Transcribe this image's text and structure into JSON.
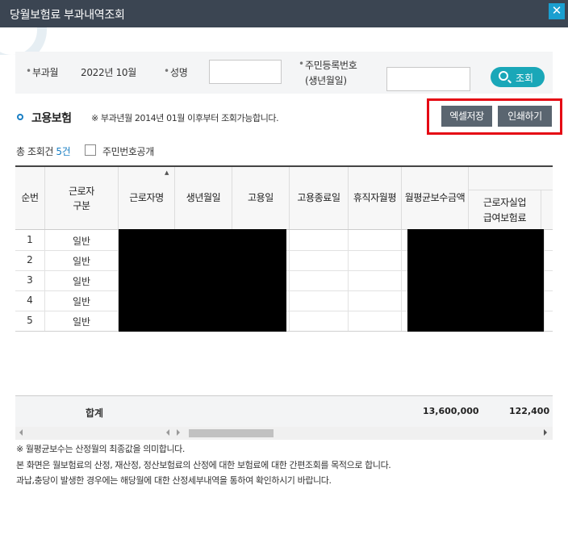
{
  "window": {
    "title": "당월보험료 부과내역조회",
    "close_icon": "✕"
  },
  "search": {
    "month_label": "부과월",
    "month_value": "2022년 10월",
    "name_label": "성명",
    "name_value": "",
    "rrn_label_1": "주민등록번호",
    "rrn_label_2": "(생년월일)",
    "rrn_value": "",
    "search_button": "조회"
  },
  "section": {
    "title": "고용보험",
    "note": "※ 부과년월 2014년 01월 이후부터 조회가능합니다.",
    "excel_button": "엑셀저장",
    "print_button": "인쇄하기"
  },
  "summary": {
    "total_label": "총 조회건",
    "total_count": "5건",
    "show_rrn_label": "주민번호공개"
  },
  "table": {
    "headers": {
      "no": "순번",
      "worker_type_1": "근로자",
      "worker_type_2": "구분",
      "worker_name": "근로자명",
      "birth": "생년월일",
      "hire_date": "고용일",
      "end_date": "고용종료일",
      "leave_month": "휴직자월평",
      "avg_wage": "월평균보수금액",
      "premium_1": "근로자실업",
      "premium_2": "급여보험료"
    },
    "rows": [
      {
        "no": "1",
        "type": "일반"
      },
      {
        "no": "2",
        "type": "일반"
      },
      {
        "no": "3",
        "type": "일반"
      },
      {
        "no": "4",
        "type": "일반"
      },
      {
        "no": "5",
        "type": "일반"
      }
    ],
    "sum_label": "합계",
    "sum_wage": "13,600,000",
    "sum_premium": "122,400"
  },
  "notes": [
    "※ 월평균보수는 산정월의 최종값을 의미합니다.",
    "본 화면은 월보험료의 산정, 재산정, 정산보험료의 산정에 대한 보험료에 대한 간편조회를 목적으로 합니다.",
    "과납,충당이 발생한 경우에는 해당월에 대한 산정세부내역을 통하여 확인하시기 바랍니다."
  ],
  "colors": {
    "titlebar": "#3b4552",
    "accent": "#1aa7b8",
    "highlight": "#e50a14",
    "button": "#5a6570"
  }
}
